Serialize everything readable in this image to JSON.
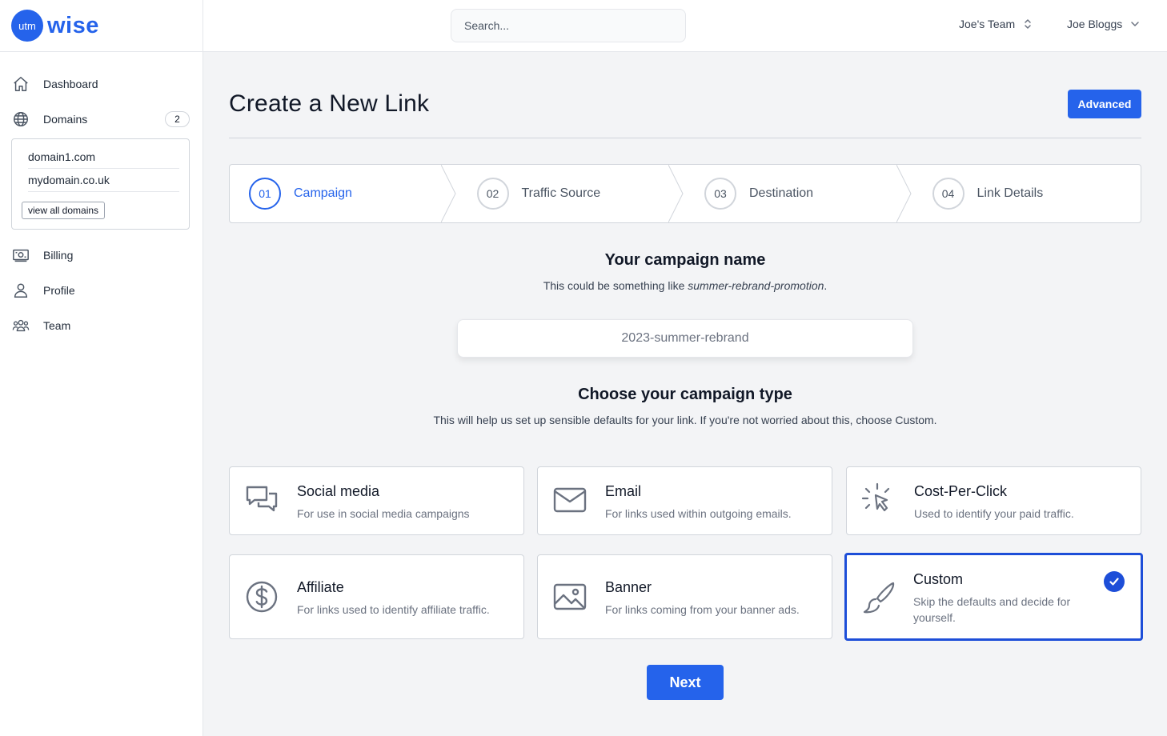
{
  "brand": {
    "circle_text": "utm",
    "name": "wise",
    "accent": "#2563eb"
  },
  "sidebar": {
    "items": [
      {
        "label": "Dashboard",
        "icon": "home-icon"
      },
      {
        "label": "Domains",
        "icon": "globe-icon",
        "badge": "2"
      },
      {
        "label": "Billing",
        "icon": "billing-icon"
      },
      {
        "label": "Profile",
        "icon": "user-icon"
      },
      {
        "label": "Team",
        "icon": "team-icon"
      }
    ],
    "domains": [
      "domain1.com",
      "mydomain.co.uk"
    ],
    "view_all_label": "view all domains"
  },
  "header": {
    "search_placeholder": "Search...",
    "team": "Joe's Team",
    "user": "Joe Bloggs"
  },
  "page": {
    "title": "Create a New Link",
    "advanced_label": "Advanced"
  },
  "steps": [
    {
      "num": "01",
      "label": "Campaign",
      "active": true
    },
    {
      "num": "02",
      "label": "Traffic Source",
      "active": false
    },
    {
      "num": "03",
      "label": "Destination",
      "active": false
    },
    {
      "num": "04",
      "label": "Link Details",
      "active": false
    }
  ],
  "campaign_name": {
    "title": "Your campaign name",
    "sub_prefix": "This could be something like ",
    "sub_example": "summer-rebrand-promotion",
    "sub_suffix": ".",
    "placeholder": "2023-summer-rebrand",
    "value": ""
  },
  "campaign_type": {
    "title": "Choose your campaign type",
    "subtitle": "This will help us set up sensible defaults for your link. If you're not worried about this, choose Custom.",
    "cards": [
      {
        "title": "Social media",
        "desc": "For use in social media campaigns",
        "icon": "chat-bubbles-icon",
        "selected": false
      },
      {
        "title": "Email",
        "desc": "For links used within outgoing emails.",
        "icon": "envelope-icon",
        "selected": false
      },
      {
        "title": "Cost-Per-Click",
        "desc": "Used to identify your paid traffic.",
        "icon": "cursor-click-icon",
        "selected": false
      },
      {
        "title": "Affiliate",
        "desc": "For links used to identify affiliate traffic.",
        "icon": "dollar-circle-icon",
        "selected": false
      },
      {
        "title": "Banner",
        "desc": "For links coming from your banner ads.",
        "icon": "image-icon",
        "selected": false
      },
      {
        "title": "Custom",
        "desc": "Skip the defaults and decide for yourself.",
        "icon": "paintbrush-icon",
        "selected": true
      }
    ]
  },
  "next_label": "Next"
}
